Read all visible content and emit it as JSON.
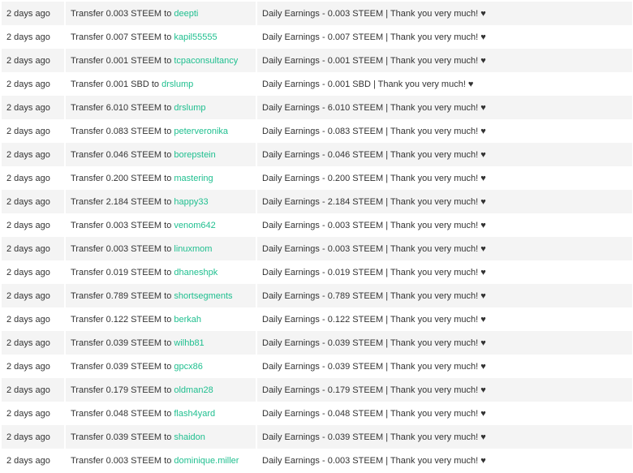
{
  "transfers": [
    {
      "date": "2 days ago",
      "prefix": "Transfer 0.003 STEEM to",
      "to": "deepti",
      "memo": "Daily Earnings - 0.003 STEEM | Thank you very much! ♥"
    },
    {
      "date": "2 days ago",
      "prefix": "Transfer 0.007 STEEM to",
      "to": "kapil55555",
      "memo": "Daily Earnings - 0.007 STEEM | Thank you very much! ♥"
    },
    {
      "date": "2 days ago",
      "prefix": "Transfer 0.001 STEEM to",
      "to": "tcpaconsultancy",
      "memo": "Daily Earnings - 0.001 STEEM | Thank you very much! ♥"
    },
    {
      "date": "2 days ago",
      "prefix": "Transfer 0.001 SBD to",
      "to": "drslump",
      "memo": "Daily Earnings - 0.001 SBD | Thank you very much! ♥"
    },
    {
      "date": "2 days ago",
      "prefix": "Transfer 6.010 STEEM to",
      "to": "drslump",
      "memo": "Daily Earnings - 6.010 STEEM | Thank you very much! ♥"
    },
    {
      "date": "2 days ago",
      "prefix": "Transfer 0.083 STEEM to",
      "to": "peterveronika",
      "memo": "Daily Earnings - 0.083 STEEM | Thank you very much! ♥"
    },
    {
      "date": "2 days ago",
      "prefix": "Transfer 0.046 STEEM to",
      "to": "borepstein",
      "memo": "Daily Earnings - 0.046 STEEM | Thank you very much! ♥"
    },
    {
      "date": "2 days ago",
      "prefix": "Transfer 0.200 STEEM to",
      "to": "mastering",
      "memo": "Daily Earnings - 0.200 STEEM | Thank you very much! ♥"
    },
    {
      "date": "2 days ago",
      "prefix": "Transfer 2.184 STEEM to",
      "to": "happy33",
      "memo": "Daily Earnings - 2.184 STEEM | Thank you very much! ♥"
    },
    {
      "date": "2 days ago",
      "prefix": "Transfer 0.003 STEEM to",
      "to": "venom642",
      "memo": "Daily Earnings - 0.003 STEEM | Thank you very much! ♥"
    },
    {
      "date": "2 days ago",
      "prefix": "Transfer 0.003 STEEM to",
      "to": "linuxmom",
      "memo": "Daily Earnings - 0.003 STEEM | Thank you very much! ♥"
    },
    {
      "date": "2 days ago",
      "prefix": "Transfer 0.019 STEEM to",
      "to": "dhaneshpk",
      "memo": "Daily Earnings - 0.019 STEEM | Thank you very much! ♥"
    },
    {
      "date": "2 days ago",
      "prefix": "Transfer 0.789 STEEM to",
      "to": "shortsegments",
      "memo": "Daily Earnings - 0.789 STEEM | Thank you very much! ♥"
    },
    {
      "date": "2 days ago",
      "prefix": "Transfer 0.122 STEEM to",
      "to": "berkah",
      "memo": "Daily Earnings - 0.122 STEEM | Thank you very much! ♥"
    },
    {
      "date": "2 days ago",
      "prefix": "Transfer 0.039 STEEM to",
      "to": "wilhb81",
      "memo": "Daily Earnings - 0.039 STEEM | Thank you very much! ♥"
    },
    {
      "date": "2 days ago",
      "prefix": "Transfer 0.039 STEEM to",
      "to": "gpcx86",
      "memo": "Daily Earnings - 0.039 STEEM | Thank you very much! ♥"
    },
    {
      "date": "2 days ago",
      "prefix": "Transfer 0.179 STEEM to",
      "to": "oldman28",
      "memo": "Daily Earnings - 0.179 STEEM | Thank you very much! ♥"
    },
    {
      "date": "2 days ago",
      "prefix": "Transfer 0.048 STEEM to",
      "to": "flash4yard",
      "memo": "Daily Earnings - 0.048 STEEM | Thank you very much! ♥"
    },
    {
      "date": "2 days ago",
      "prefix": "Transfer 0.039 STEEM to",
      "to": "shaidon",
      "memo": "Daily Earnings - 0.039 STEEM | Thank you very much! ♥"
    },
    {
      "date": "2 days ago",
      "prefix": "Transfer 0.003 STEEM to",
      "to": "dominique.miller",
      "memo": "Daily Earnings - 0.003 STEEM | Thank you very much! ♥"
    }
  ],
  "colors": {
    "link": "#1fbf8f",
    "row_shaded": "#f4f4f4",
    "text": "#333333"
  }
}
